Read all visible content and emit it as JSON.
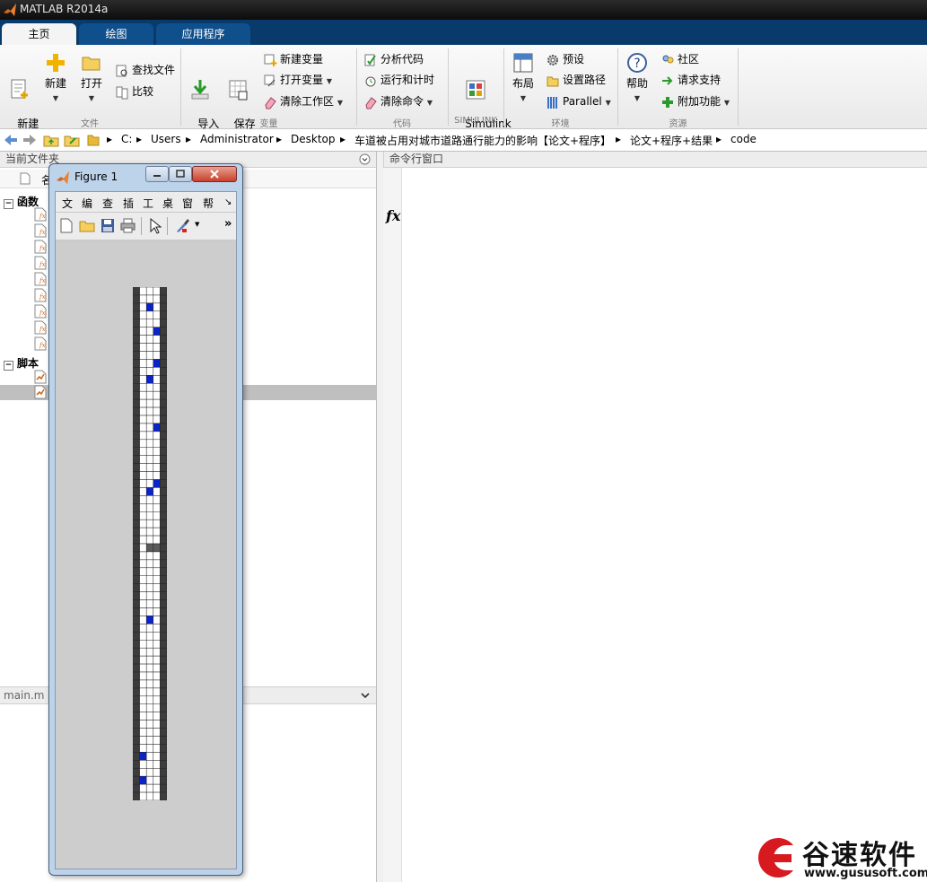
{
  "window": {
    "title": "MATLAB R2014a"
  },
  "tabs": [
    {
      "label": "主页"
    },
    {
      "label": "绘图"
    },
    {
      "label": "应用程序"
    }
  ],
  "ribbon": {
    "file": {
      "group": "文件",
      "new_script": "新建\n脚本",
      "new": "新建",
      "open": "打开",
      "find_files": "查找文件",
      "compare": "比较"
    },
    "variable": {
      "group": "变量",
      "import": "导入\n数据",
      "save_ws": "保存\n工作区",
      "new_var": "新建变量",
      "open_var": "打开变量",
      "clear_ws": "清除工作区"
    },
    "code": {
      "group": "代码",
      "analyze": "分析代码",
      "run_time": "运行和计时",
      "clear_cmd": "清除命令"
    },
    "simulink": {
      "group": "SIMULINK",
      "lib": "Simulink\n库"
    },
    "env": {
      "group": "环境",
      "layout": "布局",
      "prefs": "预设",
      "set_path": "设置路径",
      "parallel": "Parallel"
    },
    "res": {
      "group": "资源",
      "help": "帮助",
      "community": "社区",
      "support": "请求支持",
      "addons": "附加功能"
    }
  },
  "address": {
    "crumbs": [
      "C:",
      "Users",
      "Administrator",
      "Desktop",
      "车道被占用对城市道路通行能力的影响【论文+程序】",
      "论文+程序+结果",
      "code"
    ]
  },
  "current_folder": {
    "title": "当前文件夹",
    "name_col": "名",
    "sections": [
      {
        "label": "函数"
      },
      {
        "label": "脚本"
      }
    ]
  },
  "details": {
    "title": "main.m ("
  },
  "command_window": {
    "title": "命令行窗口",
    "fx": "fx"
  },
  "figure": {
    "title": "Figure 1",
    "menu": [
      "文",
      "编",
      "查",
      "插",
      "工",
      "桌",
      "窗",
      "帮"
    ],
    "grid": {
      "cols": 5,
      "rows": 64,
      "dark_cols": [
        0,
        4
      ],
      "blue_cells": [
        [
          2,
          2
        ],
        [
          3,
          5
        ],
        [
          3,
          9
        ],
        [
          2,
          11
        ],
        [
          3,
          17
        ],
        [
          3,
          24
        ],
        [
          2,
          25
        ],
        [
          2,
          41
        ],
        [
          1,
          58
        ],
        [
          1,
          61
        ]
      ],
      "gray_cells": [
        [
          2,
          32
        ],
        [
          3,
          32
        ]
      ],
      "colors": {
        "white": "#ffffff",
        "dark": "#3c3c3c",
        "blue": "#0a24c9",
        "gray": "#5a5a5a"
      }
    }
  },
  "watermark": {
    "brand": "谷速软件",
    "url": "www.gususoft.com"
  }
}
